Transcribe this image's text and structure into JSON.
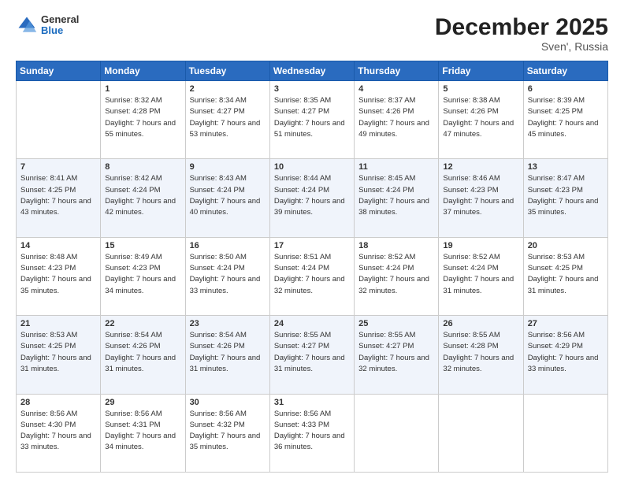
{
  "header": {
    "logo_general": "General",
    "logo_blue": "Blue",
    "month_title": "December 2025",
    "location": "Sven', Russia"
  },
  "days_of_week": [
    "Sunday",
    "Monday",
    "Tuesday",
    "Wednesday",
    "Thursday",
    "Friday",
    "Saturday"
  ],
  "weeks": [
    [
      {
        "day": "",
        "sunrise": "",
        "sunset": "",
        "daylight": ""
      },
      {
        "day": "1",
        "sunrise": "8:32 AM",
        "sunset": "4:28 PM",
        "daylight": "7 hours and 55 minutes."
      },
      {
        "day": "2",
        "sunrise": "8:34 AM",
        "sunset": "4:27 PM",
        "daylight": "7 hours and 53 minutes."
      },
      {
        "day": "3",
        "sunrise": "8:35 AM",
        "sunset": "4:27 PM",
        "daylight": "7 hours and 51 minutes."
      },
      {
        "day": "4",
        "sunrise": "8:37 AM",
        "sunset": "4:26 PM",
        "daylight": "7 hours and 49 minutes."
      },
      {
        "day": "5",
        "sunrise": "8:38 AM",
        "sunset": "4:26 PM",
        "daylight": "7 hours and 47 minutes."
      },
      {
        "day": "6",
        "sunrise": "8:39 AM",
        "sunset": "4:25 PM",
        "daylight": "7 hours and 45 minutes."
      }
    ],
    [
      {
        "day": "7",
        "sunrise": "8:41 AM",
        "sunset": "4:25 PM",
        "daylight": "7 hours and 43 minutes."
      },
      {
        "day": "8",
        "sunrise": "8:42 AM",
        "sunset": "4:24 PM",
        "daylight": "7 hours and 42 minutes."
      },
      {
        "day": "9",
        "sunrise": "8:43 AM",
        "sunset": "4:24 PM",
        "daylight": "7 hours and 40 minutes."
      },
      {
        "day": "10",
        "sunrise": "8:44 AM",
        "sunset": "4:24 PM",
        "daylight": "7 hours and 39 minutes."
      },
      {
        "day": "11",
        "sunrise": "8:45 AM",
        "sunset": "4:24 PM",
        "daylight": "7 hours and 38 minutes."
      },
      {
        "day": "12",
        "sunrise": "8:46 AM",
        "sunset": "4:23 PM",
        "daylight": "7 hours and 37 minutes."
      },
      {
        "day": "13",
        "sunrise": "8:47 AM",
        "sunset": "4:23 PM",
        "daylight": "7 hours and 35 minutes."
      }
    ],
    [
      {
        "day": "14",
        "sunrise": "8:48 AM",
        "sunset": "4:23 PM",
        "daylight": "7 hours and 35 minutes."
      },
      {
        "day": "15",
        "sunrise": "8:49 AM",
        "sunset": "4:23 PM",
        "daylight": "7 hours and 34 minutes."
      },
      {
        "day": "16",
        "sunrise": "8:50 AM",
        "sunset": "4:24 PM",
        "daylight": "7 hours and 33 minutes."
      },
      {
        "day": "17",
        "sunrise": "8:51 AM",
        "sunset": "4:24 PM",
        "daylight": "7 hours and 32 minutes."
      },
      {
        "day": "18",
        "sunrise": "8:52 AM",
        "sunset": "4:24 PM",
        "daylight": "7 hours and 32 minutes."
      },
      {
        "day": "19",
        "sunrise": "8:52 AM",
        "sunset": "4:24 PM",
        "daylight": "7 hours and 31 minutes."
      },
      {
        "day": "20",
        "sunrise": "8:53 AM",
        "sunset": "4:25 PM",
        "daylight": "7 hours and 31 minutes."
      }
    ],
    [
      {
        "day": "21",
        "sunrise": "8:53 AM",
        "sunset": "4:25 PM",
        "daylight": "7 hours and 31 minutes."
      },
      {
        "day": "22",
        "sunrise": "8:54 AM",
        "sunset": "4:26 PM",
        "daylight": "7 hours and 31 minutes."
      },
      {
        "day": "23",
        "sunrise": "8:54 AM",
        "sunset": "4:26 PM",
        "daylight": "7 hours and 31 minutes."
      },
      {
        "day": "24",
        "sunrise": "8:55 AM",
        "sunset": "4:27 PM",
        "daylight": "7 hours and 31 minutes."
      },
      {
        "day": "25",
        "sunrise": "8:55 AM",
        "sunset": "4:27 PM",
        "daylight": "7 hours and 32 minutes."
      },
      {
        "day": "26",
        "sunrise": "8:55 AM",
        "sunset": "4:28 PM",
        "daylight": "7 hours and 32 minutes."
      },
      {
        "day": "27",
        "sunrise": "8:56 AM",
        "sunset": "4:29 PM",
        "daylight": "7 hours and 33 minutes."
      }
    ],
    [
      {
        "day": "28",
        "sunrise": "8:56 AM",
        "sunset": "4:30 PM",
        "daylight": "7 hours and 33 minutes."
      },
      {
        "day": "29",
        "sunrise": "8:56 AM",
        "sunset": "4:31 PM",
        "daylight": "7 hours and 34 minutes."
      },
      {
        "day": "30",
        "sunrise": "8:56 AM",
        "sunset": "4:32 PM",
        "daylight": "7 hours and 35 minutes."
      },
      {
        "day": "31",
        "sunrise": "8:56 AM",
        "sunset": "4:33 PM",
        "daylight": "7 hours and 36 minutes."
      },
      {
        "day": "",
        "sunrise": "",
        "sunset": "",
        "daylight": ""
      },
      {
        "day": "",
        "sunrise": "",
        "sunset": "",
        "daylight": ""
      },
      {
        "day": "",
        "sunrise": "",
        "sunset": "",
        "daylight": ""
      }
    ]
  ]
}
